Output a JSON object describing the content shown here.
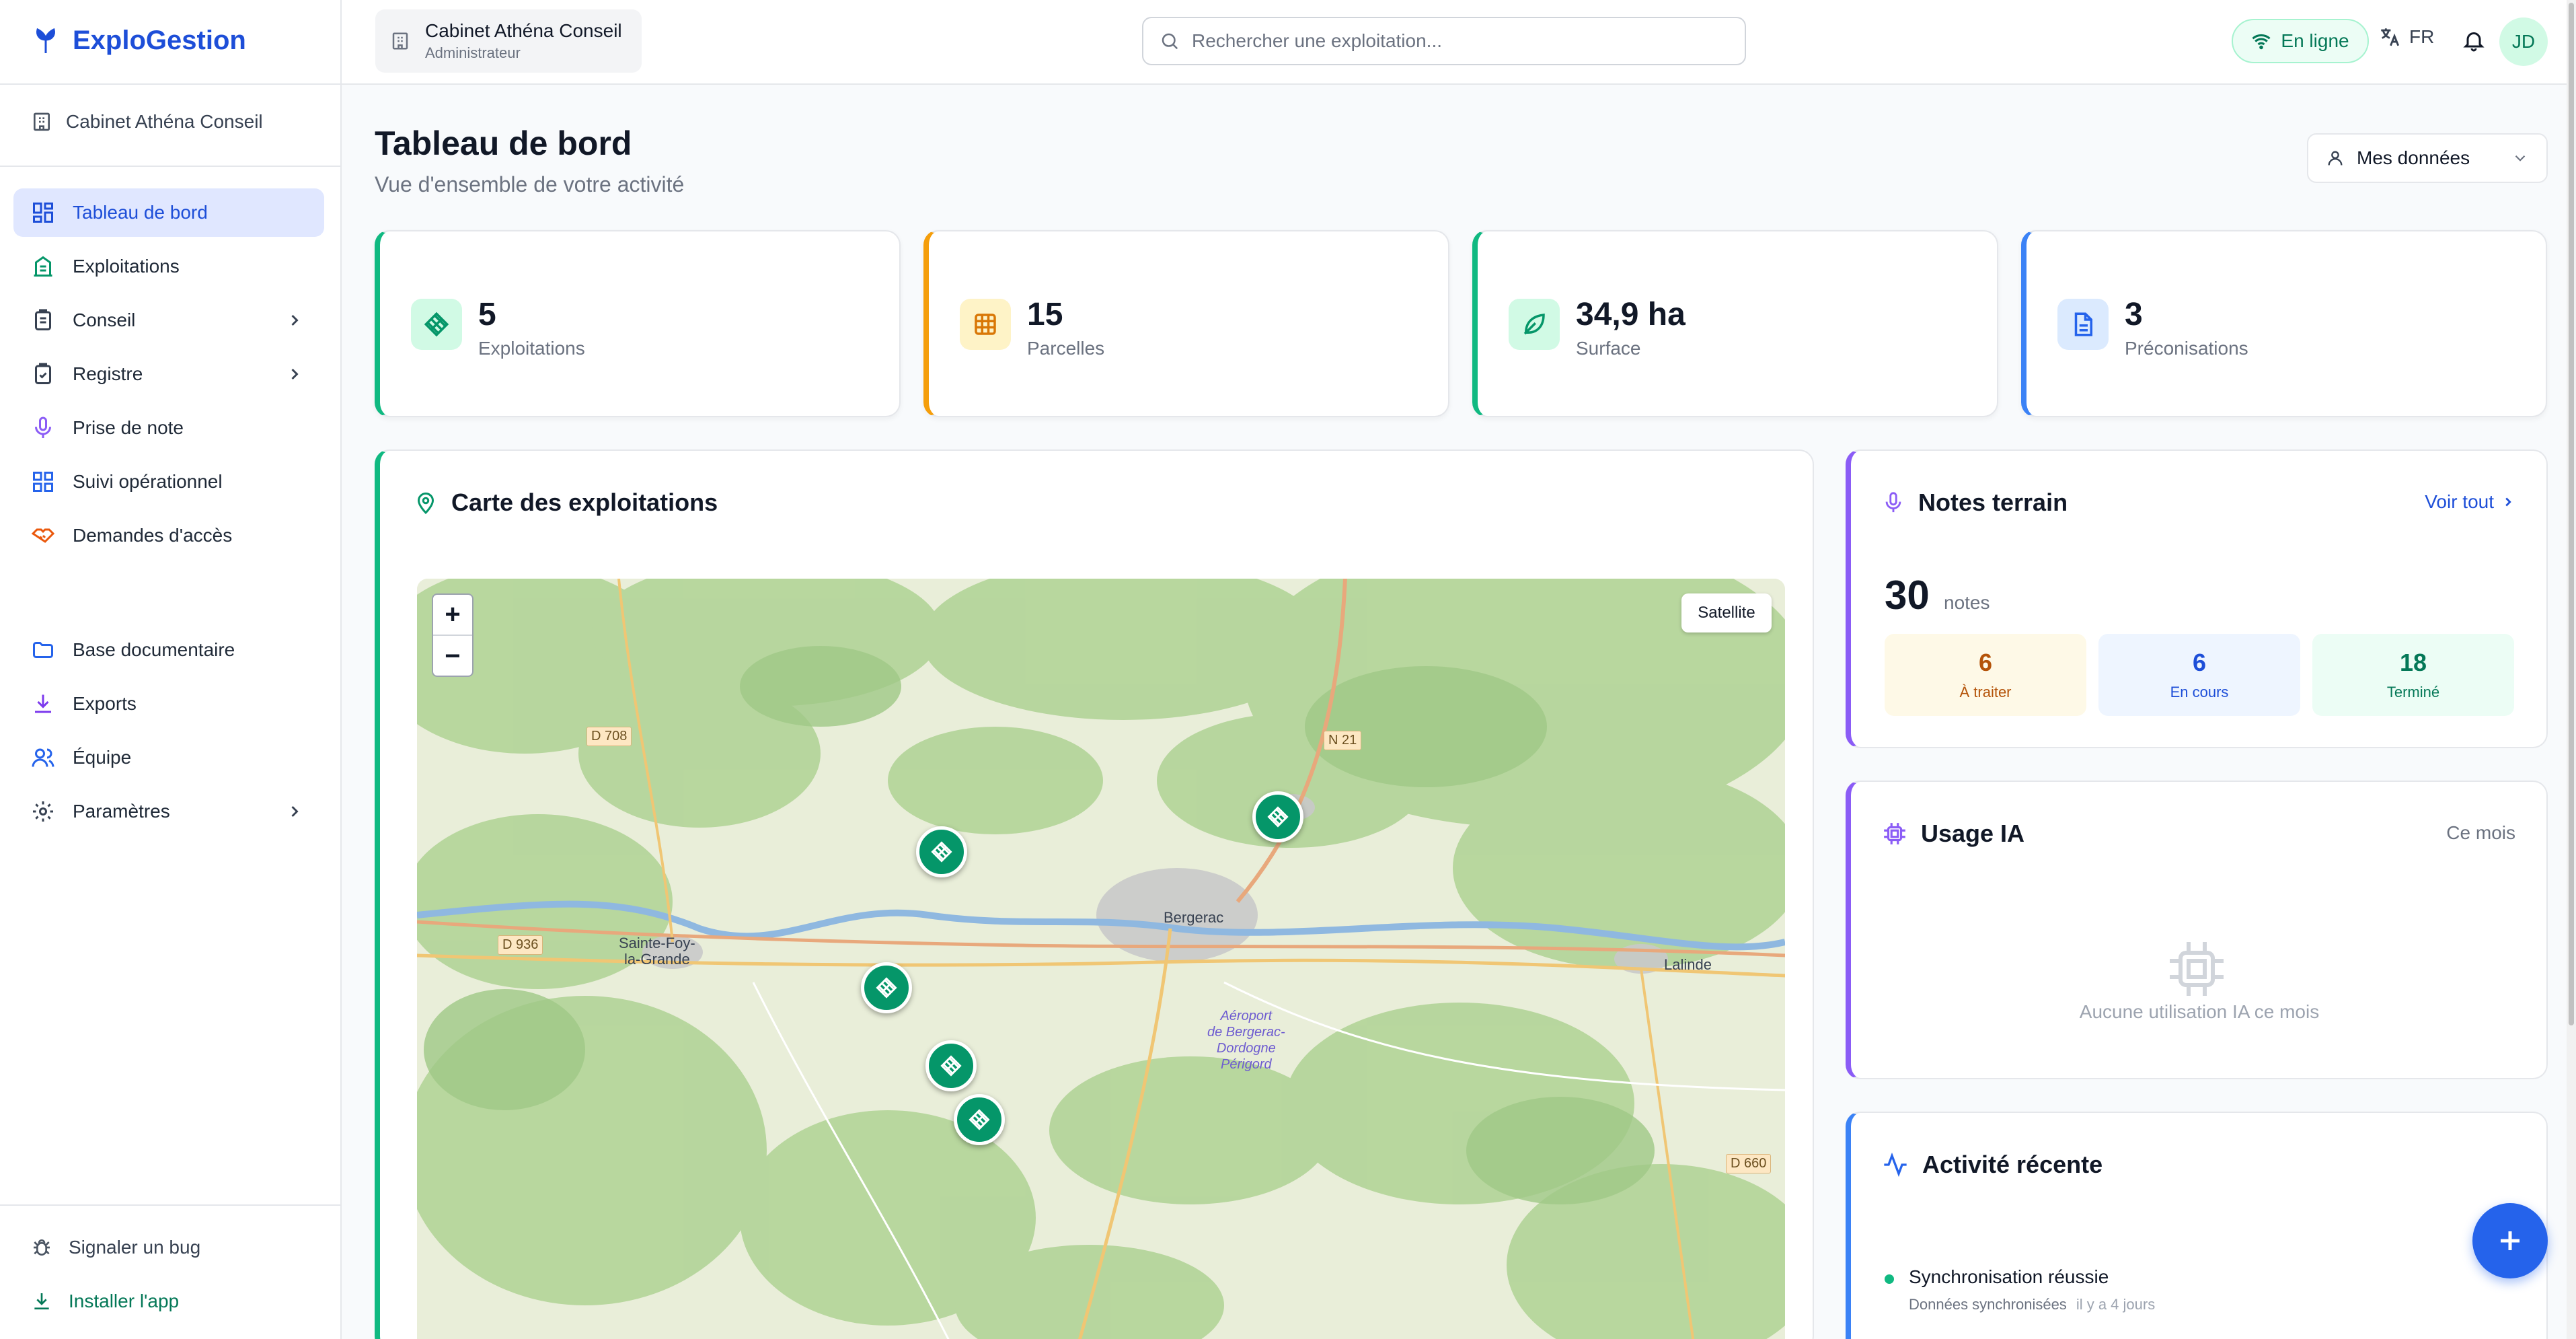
{
  "app": {
    "name": "ExploGestion"
  },
  "sidebar": {
    "organization": "Cabinet Athéna Conseil",
    "items": [
      {
        "label": "Tableau de bord",
        "icon": "dashboard-icon",
        "active": true
      },
      {
        "label": "Exploitations",
        "icon": "building-icon"
      },
      {
        "label": "Conseil",
        "icon": "clipboard-icon",
        "expandable": true
      },
      {
        "label": "Registre",
        "icon": "clipboard-check-icon",
        "expandable": true
      },
      {
        "label": "Prise de note",
        "icon": "microphone-icon"
      },
      {
        "label": "Suivi opérationnel",
        "icon": "grid-icon"
      },
      {
        "label": "Demandes d'accès",
        "icon": "handshake-icon"
      }
    ],
    "items2": [
      {
        "label": "Base documentaire",
        "icon": "folder-icon"
      },
      {
        "label": "Exports",
        "icon": "download-icon"
      },
      {
        "label": "Équipe",
        "icon": "users-icon"
      },
      {
        "label": "Paramètres",
        "icon": "gear-icon",
        "expandable": true
      }
    ],
    "bottom": [
      {
        "label": "Signaler un bug",
        "icon": "bug-icon"
      },
      {
        "label": "Installer l'app",
        "icon": "download-icon"
      }
    ]
  },
  "header": {
    "org_name": "Cabinet Athéna Conseil",
    "org_role": "Administrateur",
    "search_placeholder": "Rechercher une exploitation...",
    "status": "En ligne",
    "language": "FR",
    "user_initials": "JD"
  },
  "page": {
    "title": "Tableau de bord",
    "subtitle": "Vue d'ensemble de votre activité",
    "scope": "Mes données"
  },
  "stats": [
    {
      "value": "5",
      "label": "Exploitations",
      "color": "#10b981",
      "icon": "farm-icon"
    },
    {
      "value": "15",
      "label": "Parcelles",
      "color": "#f59e0b",
      "icon": "grid-icon"
    },
    {
      "value": "34,9 ha",
      "label": "Surface",
      "color": "#10b981",
      "icon": "leaf-icon"
    },
    {
      "value": "3",
      "label": "Préconisations",
      "color": "#3b82f6",
      "icon": "document-icon"
    }
  ],
  "map": {
    "title": "Carte des exploitations",
    "satellite_label": "Satellite",
    "zoom_in": "+",
    "zoom_out": "−",
    "places": {
      "sainte_foy": "Sainte-Foy-\nla-Grande",
      "bergerac": "Bergerac",
      "lalinde": "Lalinde",
      "airport": "Aéroport\nde Bergerac-\nDordogne\nPérigord"
    },
    "roads": {
      "d708": "D 708",
      "n21": "N 21",
      "d936": "D 936",
      "d660": "D 660"
    },
    "marker_count": 5
  },
  "notes": {
    "title": "Notes terrain",
    "see_all": "Voir tout",
    "total": "30",
    "unit": "notes",
    "todo": {
      "value": "6",
      "label": "À traiter",
      "color": "#b45309"
    },
    "in_progress": {
      "value": "6",
      "label": "En cours",
      "color": "#1d4ed8"
    },
    "done": {
      "value": "18",
      "label": "Terminé",
      "color": "#047857"
    }
  },
  "ai": {
    "title": "Usage IA",
    "period": "Ce mois",
    "empty": "Aucune utilisation IA ce mois"
  },
  "activity": {
    "title": "Activité récente",
    "items": [
      {
        "title": "Synchronisation réussie",
        "detail": "Données synchronisées",
        "time": "il y a 4 jours"
      }
    ]
  },
  "colors": {
    "brand": "#1d4ed8",
    "accent_green": "#059669",
    "notes_accent": "#8b5cf6",
    "activity_accent": "#3b82f6"
  }
}
